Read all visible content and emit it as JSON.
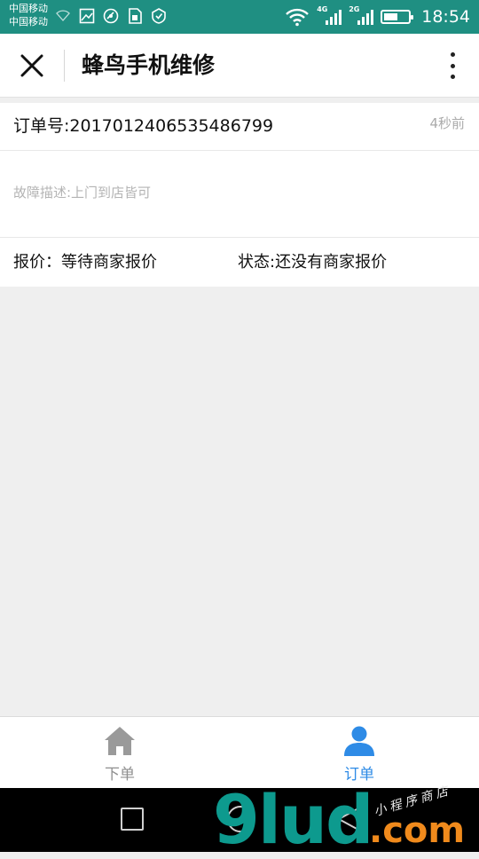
{
  "status_bar": {
    "carrier_1": "中国移动",
    "carrier_2": "中国移动",
    "network_1": "4G",
    "network_2": "2G",
    "battery_level": 0.55,
    "time": "18:54",
    "bg_color": "#1f8f82"
  },
  "title_bar": {
    "close_icon": "close-icon",
    "title": "蜂鸟手机维修",
    "more_icon": "more-vertical-icon"
  },
  "order": {
    "order_number": "订单号:2017012406535486799",
    "time_ago": "4秒前",
    "description": "故障描述:上门到店皆可",
    "quote": "报价：等待商家报价",
    "status": "状态:还没有商家报价"
  },
  "tab_bar": {
    "tabs": [
      {
        "label": "下单",
        "icon": "home-icon",
        "active": false,
        "color": "#8f8f8f"
      },
      {
        "label": "订单",
        "icon": "user-icon",
        "active": true,
        "color": "#2e8be6"
      }
    ]
  },
  "nav_bar": {
    "buttons": [
      "recents-square-icon",
      "home-circle-icon",
      "back-triangle-icon"
    ]
  },
  "watermark": {
    "logo": "9lud",
    "suffix": ".com",
    "tagline": "小程序商店"
  }
}
